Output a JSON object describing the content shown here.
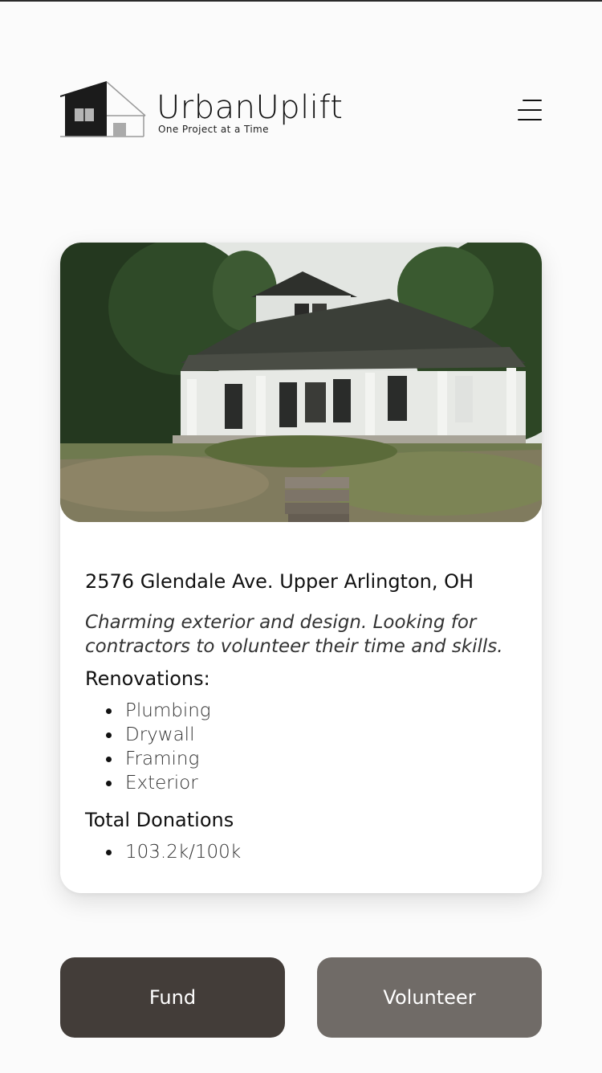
{
  "header": {
    "brand_name": "UrbanUplift",
    "tagline": "One Project at a Time",
    "logo_icon": "house-logo-icon",
    "menu_icon": "hamburger-menu-icon"
  },
  "listing": {
    "photo_alt": "Abandoned two-story white house with overgrown yard",
    "address": "2576 Glendale Ave. Upper Arlington, OH",
    "description": "Charming exterior and design. Looking for contractors to volunteer their time and skills.",
    "renovations_title": "Renovations:",
    "renovations": [
      "Plumbing",
      "Drywall",
      "Framing",
      "Exterior"
    ],
    "donations_title": "Total Donations",
    "donations": [
      "103.2k/100k"
    ]
  },
  "actions": {
    "fund_label": "Fund",
    "volunteer_label": "Volunteer"
  },
  "colors": {
    "fund_button": "#433d39",
    "volunteer_button": "#706b67",
    "background": "#fbfbfb"
  }
}
